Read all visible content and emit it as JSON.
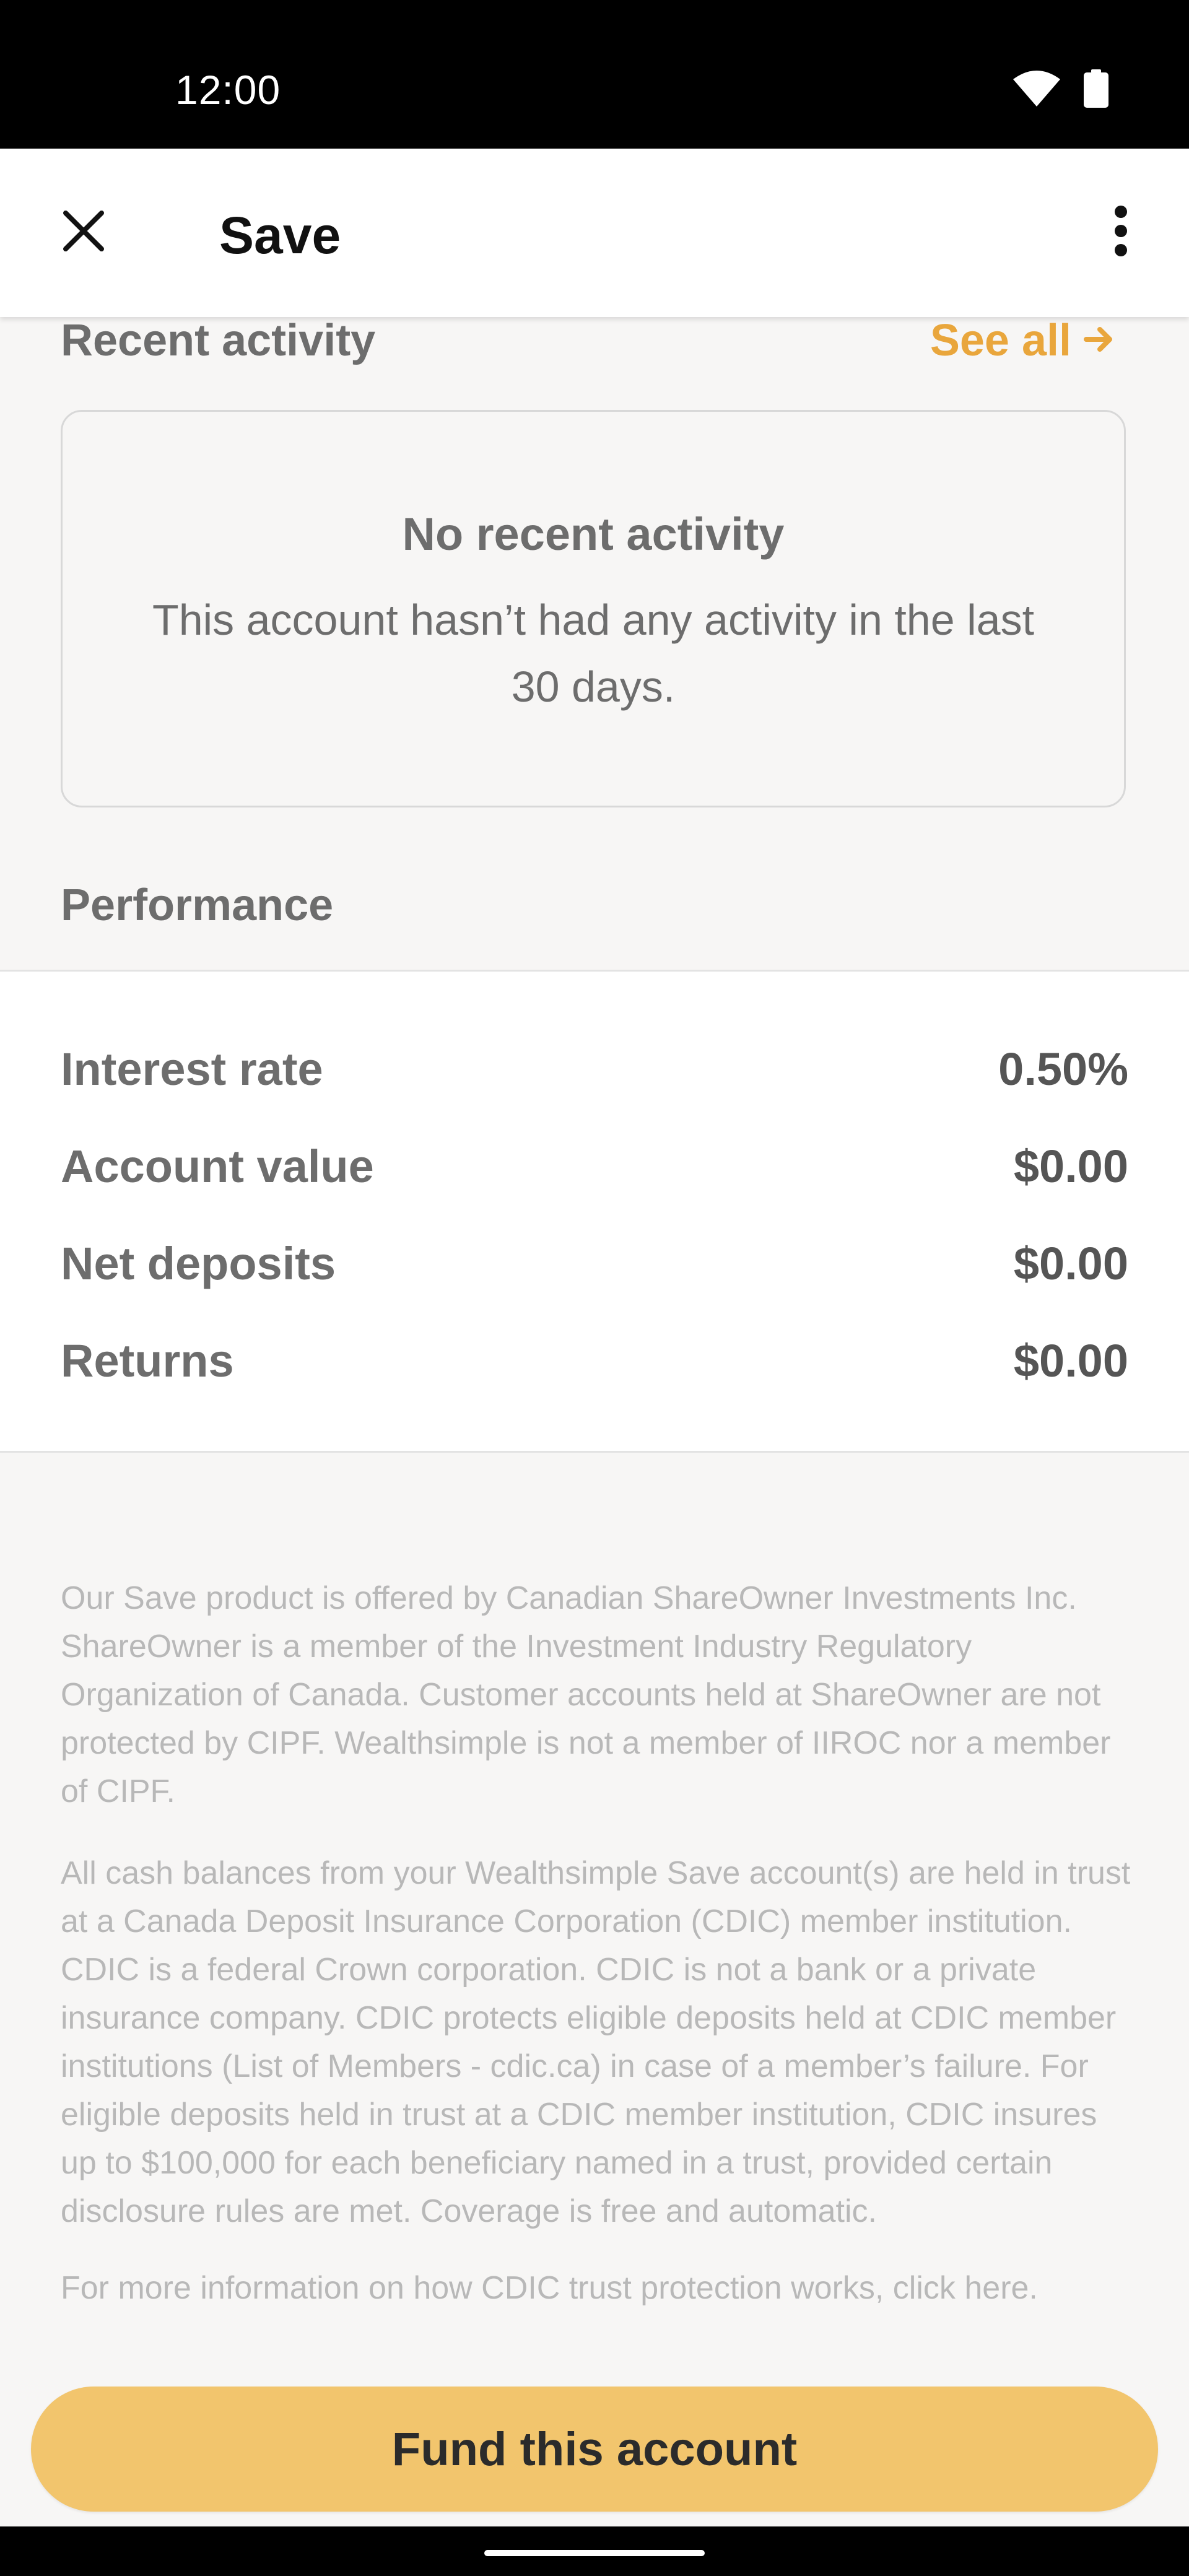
{
  "status_bar": {
    "time": "12:00",
    "icons": [
      "wifi-icon",
      "battery-icon"
    ]
  },
  "app_bar": {
    "title": "Save",
    "close_icon": "close-icon",
    "menu_icon": "more-vertical-icon"
  },
  "recent_activity": {
    "title": "Recent activity",
    "see_all": "See all",
    "see_all_icon": "arrow-right-icon",
    "empty_title": "No recent activity",
    "empty_body": "This account hasn’t had any activity in the last 30 days."
  },
  "performance": {
    "title": "Performance",
    "rows": [
      {
        "label": "Interest rate",
        "value": "0.50%"
      },
      {
        "label": "Account value",
        "value": "$0.00"
      },
      {
        "label": "Net deposits",
        "value": "$0.00"
      },
      {
        "label": "Returns",
        "value": "$0.00"
      }
    ]
  },
  "disclaimers": [
    "Our Save product is offered by Canadian ShareOwner Investments Inc. ShareOwner is a member of the Investment Industry Regulatory Organization of Canada. Customer accounts held at ShareOwner are not protected by CIPF. Wealthsimple is not a member of IIROC nor a member of CIPF.",
    "All cash balances from your Wealthsimple Save account(s) are held in trust at a Canada Deposit Insurance Corporation (CDIC) member institution. CDIC is a federal Crown corporation. CDIC is not a bank or a private insurance company. CDIC protects eligible deposits held at CDIC member institutions (List of Members - cdic.ca) in case of a member’s failure. For eligible deposits held in trust at a CDIC member institution, CDIC insures up to $100,000 for each beneficiary named in a trust, provided certain disclosure rules are met. Coverage is free and automatic.",
    "For more information on how CDIC trust protection works, click here."
  ],
  "fund_button": {
    "label": "Fund this account"
  },
  "colors": {
    "accent": "#e9a63c",
    "button": "#f2c56d",
    "background": "#f7f6f5"
  }
}
